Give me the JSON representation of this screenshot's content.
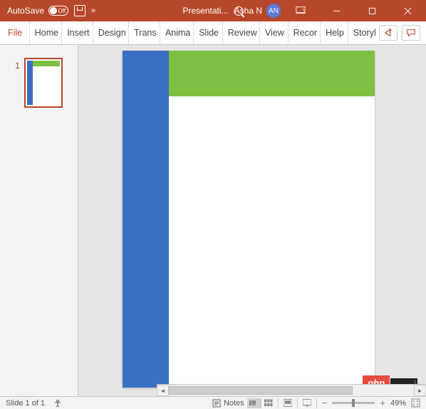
{
  "titlebar": {
    "autosave_label": "AutoSave",
    "autosave_state": "Off",
    "document_name": "Presentati...",
    "user_name": "Asha N",
    "user_initials": "AN"
  },
  "ribbon": {
    "tabs": [
      {
        "label": "File"
      },
      {
        "label": "Home"
      },
      {
        "label": "Insert"
      },
      {
        "label": "Design"
      },
      {
        "label": "Trans"
      },
      {
        "label": "Anima"
      },
      {
        "label": "Slide"
      },
      {
        "label": "Review"
      },
      {
        "label": "View"
      },
      {
        "label": "Recor"
      },
      {
        "label": "Help"
      },
      {
        "label": "Storyl"
      }
    ]
  },
  "thumbnails": {
    "slides": [
      {
        "number": "1"
      }
    ]
  },
  "statusbar": {
    "slide_indicator": "Slide 1 of 1",
    "notes_label": "Notes",
    "zoom_value": "49%"
  },
  "watermark": {
    "text": "php"
  },
  "colors": {
    "accent": "#b7472a",
    "slide_blue": "#3b6fc4",
    "slide_green": "#7cc142"
  }
}
